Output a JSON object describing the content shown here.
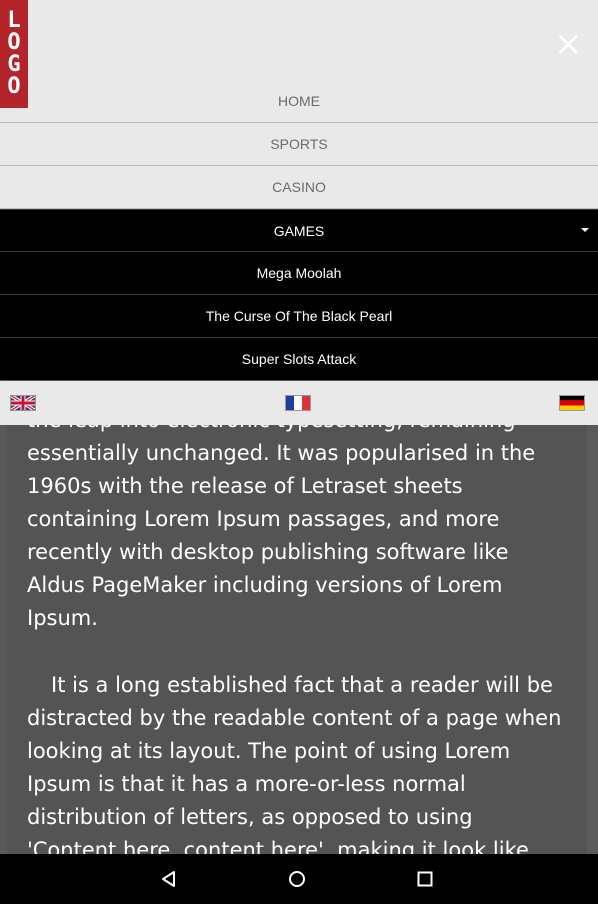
{
  "header": {
    "logo_letters": [
      "L",
      "O",
      "G",
      "O"
    ],
    "close_label": "×"
  },
  "menu": {
    "items": [
      {
        "label": "HOME"
      },
      {
        "label": "SPORTS"
      },
      {
        "label": "CASINO"
      },
      {
        "label": "GAMES"
      }
    ],
    "games_submenu": [
      {
        "label": "Mega Moolah"
      },
      {
        "label": "The Curse Of The Black Pearl"
      },
      {
        "label": "Super Slots Attack"
      }
    ]
  },
  "languages": [
    {
      "name": "english-flag"
    },
    {
      "name": "french-flag"
    },
    {
      "name": "german-flag"
    }
  ],
  "article": {
    "paragraph1": "the leap into electronic typesetting, remaining essentially unchanged. It was popularised in the 1960s with the release of Letraset sheets containing Lorem Ipsum passages, and more recently with desktop publishing software like Aldus PageMaker including versions of Lorem Ipsum.",
    "paragraph2": "It is a long established fact that a reader will be distracted by the readable content of a page when looking at its layout. The point of using Lorem Ipsum is that it has a more-or-less normal distribution of letters, as opposed to using 'Content here, content here', making it look like readable English. Many desktop publishing packages and"
  },
  "colors": {
    "logo_bg": "#b3242b",
    "header_bg": "#e9e9e9",
    "submenu_bg": "#000000",
    "content_bg": "#545454"
  }
}
